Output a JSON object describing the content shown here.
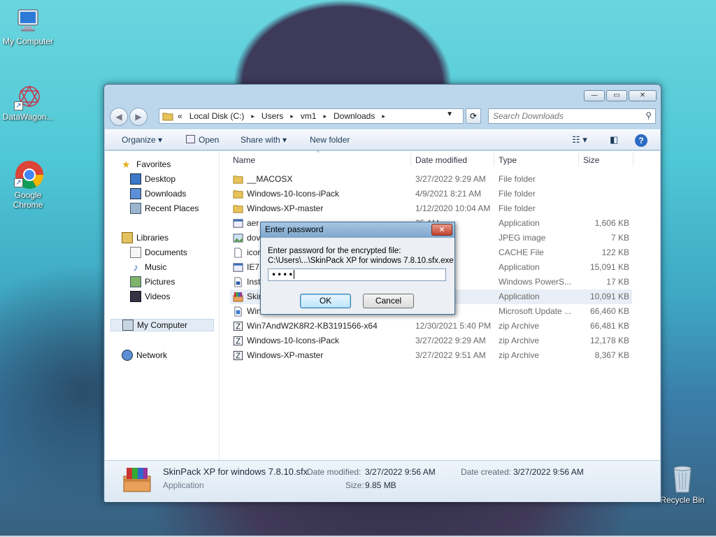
{
  "desktop": {
    "icons": [
      {
        "label": "My Computer",
        "icon": "my-computer-icon"
      },
      {
        "label": "DataWagon...",
        "icon": "datawagon-icon"
      },
      {
        "label": "Google Chrome",
        "icon": "chrome-icon"
      },
      {
        "label": "Recycle Bin",
        "icon": "recycle-bin-icon"
      }
    ]
  },
  "explorer": {
    "caption_buttons": {
      "minimize": "—",
      "maximize": "▭",
      "close": "✕"
    },
    "address": {
      "prefix": "«",
      "crumbs": [
        "Local Disk (C:)",
        "Users",
        "vm1",
        "Downloads"
      ],
      "separator": "▸"
    },
    "search_placeholder": "Search Downloads",
    "toolbar": {
      "organize": "Organize ▾",
      "open": "Open",
      "share_with": "Share with ▾",
      "new_folder": "New folder"
    },
    "nav_pane": {
      "favorites": "Favorites",
      "desktop": "Desktop",
      "downloads": "Downloads",
      "recent_places": "Recent Places",
      "libraries": "Libraries",
      "documents": "Documents",
      "music": "Music",
      "pictures": "Pictures",
      "videos": "Videos",
      "my_computer": "My Computer",
      "network": "Network"
    },
    "columns": {
      "name": "Name",
      "date": "Date modified",
      "type": "Type",
      "size": "Size"
    },
    "files": [
      {
        "name": "__MACOSX",
        "date": "3/27/2022 9:29 AM",
        "type": "File folder",
        "size": "",
        "icon": "folder"
      },
      {
        "name": "Windows-10-Icons-iPack",
        "date": "4/9/2021 8:21 AM",
        "type": "File folder",
        "size": "",
        "icon": "folder"
      },
      {
        "name": "Windows-XP-master",
        "date": "1/12/2020 10:04 AM",
        "type": "File folder",
        "size": "",
        "icon": "folder"
      },
      {
        "name": "aer",
        "date": "25 AM",
        "type": "Application",
        "size": "1,606 KB",
        "icon": "app"
      },
      {
        "name": "dov",
        "date": "39 AM",
        "type": "JPEG image",
        "size": "7 KB",
        "icon": "image"
      },
      {
        "name": "icor",
        "date": "54 AM",
        "type": "CACHE File",
        "size": "122 KB",
        "icon": "file"
      },
      {
        "name": "IE7-",
        "date": "23 AM",
        "type": "Application",
        "size": "15,091 KB",
        "icon": "app"
      },
      {
        "name": "Inst",
        "date": "25 PM",
        "type": "Windows PowerS...",
        "size": "17 KB",
        "icon": "script"
      },
      {
        "name": "Skin",
        "date": "56 AM",
        "type": "Application",
        "size": "10,091 KB",
        "icon": "archive-app"
      },
      {
        "name": "Win",
        "date": "0:07 AM",
        "type": "Microsoft Update ...",
        "size": "66,460 KB",
        "icon": "update"
      },
      {
        "name": "Win7AndW2K8R2-KB3191566-x64",
        "date": "12/30/2021 5:40 PM",
        "type": "zip Archive",
        "size": "66,481 KB",
        "icon": "zip"
      },
      {
        "name": "Windows-10-Icons-iPack",
        "date": "3/27/2022 9:29 AM",
        "type": "zip Archive",
        "size": "12,178 KB",
        "icon": "zip"
      },
      {
        "name": "Windows-XP-master",
        "date": "3/27/2022 9:51 AM",
        "type": "zip Archive",
        "size": "8,367 KB",
        "icon": "zip"
      }
    ],
    "details": {
      "filename": "SkinPack XP for windows 7.8.10.sfx",
      "filetype": "Application",
      "date_modified_label": "Date modified:",
      "date_modified": "3/27/2022 9:56 AM",
      "date_created_label": "Date created:",
      "date_created": "3/27/2022 9:56 AM",
      "size_label": "Size:",
      "size": "9.85 MB"
    }
  },
  "dialog": {
    "title": "Enter password",
    "line1": "Enter password for the encrypted file:",
    "line2": "C:\\Users\\...\\SkinPack XP for windows 7.8.10.sfx.exe",
    "password_value": "••••",
    "ok": "OK",
    "cancel": "Cancel"
  }
}
